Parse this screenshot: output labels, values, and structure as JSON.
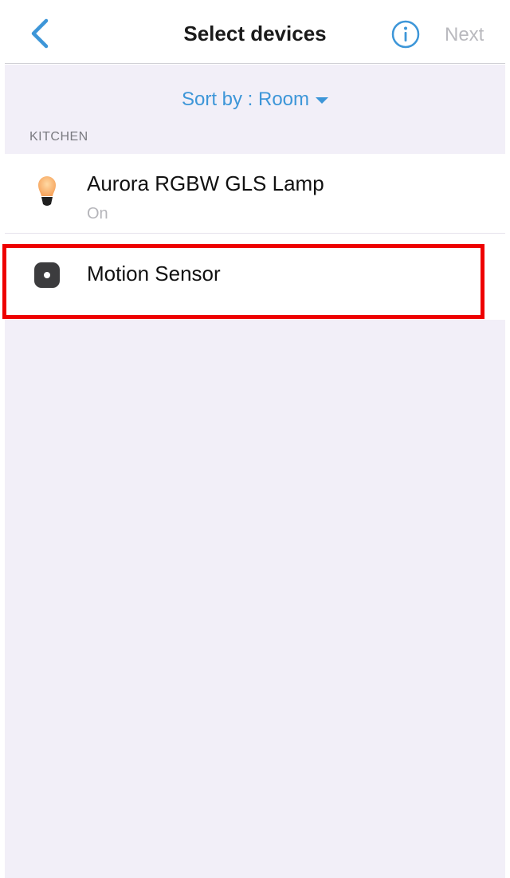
{
  "navbar": {
    "title": "Select devices",
    "next_label": "Next"
  },
  "sort": {
    "label": "Sort by : Room"
  },
  "sections": [
    {
      "header": "KITCHEN",
      "devices": [
        {
          "name": "Aurora RGBW GLS Lamp",
          "status": "On",
          "icon": "bulb-icon"
        },
        {
          "name": "Motion Sensor",
          "status": "",
          "icon": "motion-sensor-icon"
        }
      ]
    }
  ],
  "colors": {
    "accent": "#3d96d8",
    "highlight": "#ee0000",
    "background": "#f2eff8",
    "disabled": "#b9b9be"
  }
}
